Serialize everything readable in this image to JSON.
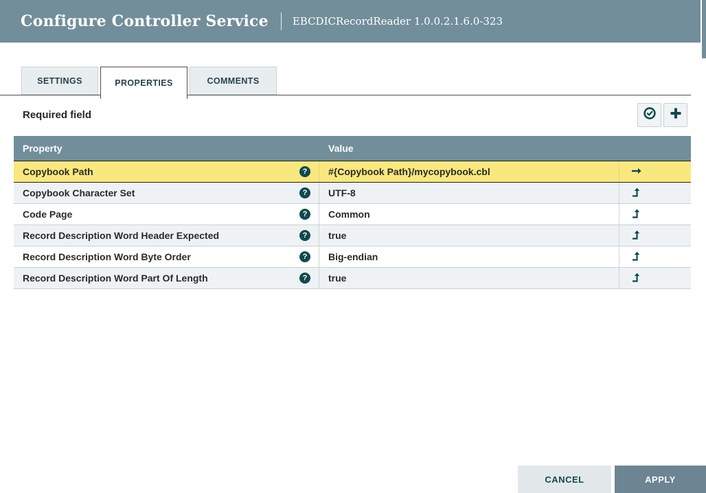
{
  "dialog": {
    "title": "Configure Controller Service",
    "subtitle": "EBCDICRecordReader 1.0.0.2.1.6.0-323"
  },
  "tabs": [
    {
      "label": "SETTINGS",
      "active": false
    },
    {
      "label": "PROPERTIES",
      "active": true
    },
    {
      "label": "COMMENTS",
      "active": false
    }
  ],
  "properties_panel": {
    "required_field_label": "Required field",
    "buttons": [
      {
        "icon": "check-circle-icon",
        "purpose": "verify-properties"
      },
      {
        "icon": "plus-icon",
        "purpose": "add-property"
      }
    ]
  },
  "table": {
    "columns": [
      "Property",
      "Value"
    ],
    "help_icon": "question-circle-icon",
    "rows": [
      {
        "property": "Copybook Path",
        "value": "#{Copybook Path}/mycopybook.cbl",
        "action_icon": "arrow-right-icon",
        "selected": true
      },
      {
        "property": "Copybook Character Set",
        "value": "UTF-8",
        "action_icon": "level-up-arrow-icon",
        "selected": false
      },
      {
        "property": "Code Page",
        "value": "Common",
        "action_icon": "level-up-arrow-icon",
        "selected": false
      },
      {
        "property": "Record Description Word Header Expected",
        "value": "true",
        "action_icon": "level-up-arrow-icon",
        "selected": false
      },
      {
        "property": "Record Description Word Byte Order",
        "value": "Big-endian",
        "action_icon": "level-up-arrow-icon",
        "selected": false
      },
      {
        "property": "Record Description Word Part Of Length",
        "value": "true",
        "action_icon": "level-up-arrow-icon",
        "selected": false
      }
    ]
  },
  "footer": {
    "cancel_label": "CANCEL",
    "apply_label": "APPLY"
  },
  "colors": {
    "header_bg": "#728e9b",
    "accent_teal": "#10494d",
    "selected_row_bg": "#f8e87d",
    "alt_row_bg": "#eef2f4",
    "apply_bg": "#6d8593"
  }
}
